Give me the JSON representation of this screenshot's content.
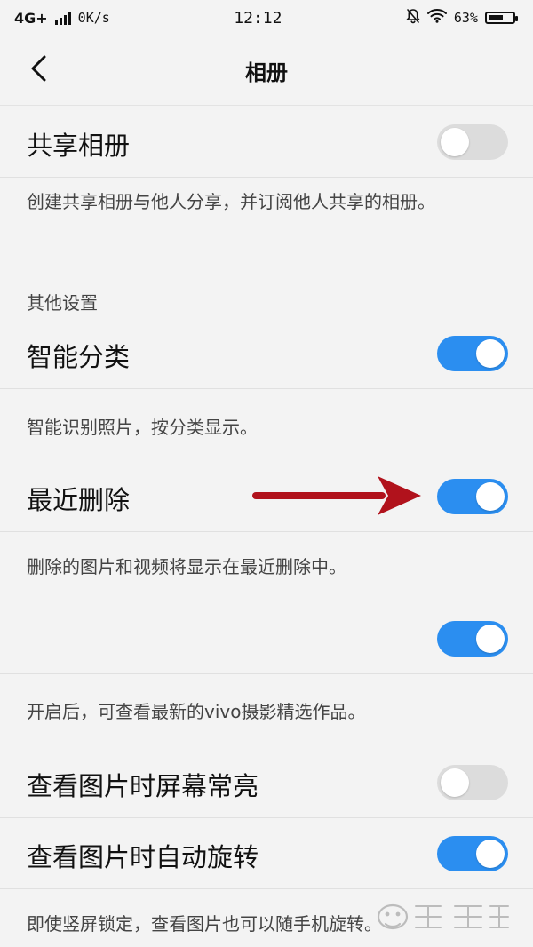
{
  "status_bar": {
    "network": "4G+",
    "speed": "0K/s",
    "time": "12:12",
    "battery_percent_text": "63%",
    "battery_level": 0.63,
    "icons": [
      "signal-icon",
      "mute-notification-icon",
      "wifi-icon",
      "battery-icon"
    ]
  },
  "header": {
    "title": "相册",
    "back_icon": "chevron-left-icon"
  },
  "settings": {
    "shared_album": {
      "label": "共享相册",
      "enabled": false,
      "description": "创建共享相册与他人分享，并订阅他人共享的相册。"
    },
    "other_section_title": "其他设置",
    "smart_classify": {
      "label": "智能分类",
      "enabled": true,
      "description": "智能识别照片，按分类显示。"
    },
    "recently_deleted": {
      "label": "最近删除",
      "enabled": true,
      "description": "删除的图片和视频将显示在最近删除中。"
    },
    "vivo_featured": {
      "label": "",
      "enabled": true,
      "description": "开启后，可查看最新的vivo摄影精选作品。"
    },
    "keep_screen_on": {
      "label": "查看图片时屏幕常亮",
      "enabled": false
    },
    "auto_rotate": {
      "label": "查看图片时自动旋转",
      "enabled": true,
      "description": "即使竖屏锁定，查看图片也可以随手机旋转。"
    }
  },
  "annotation": {
    "arrow_color": "#b1121c"
  },
  "watermark": {
    "text": "Baidu经验"
  },
  "colors": {
    "toggle_on": "#2b8ef0",
    "toggle_off": "#dcdcdc",
    "background": "#f3f3f3"
  }
}
